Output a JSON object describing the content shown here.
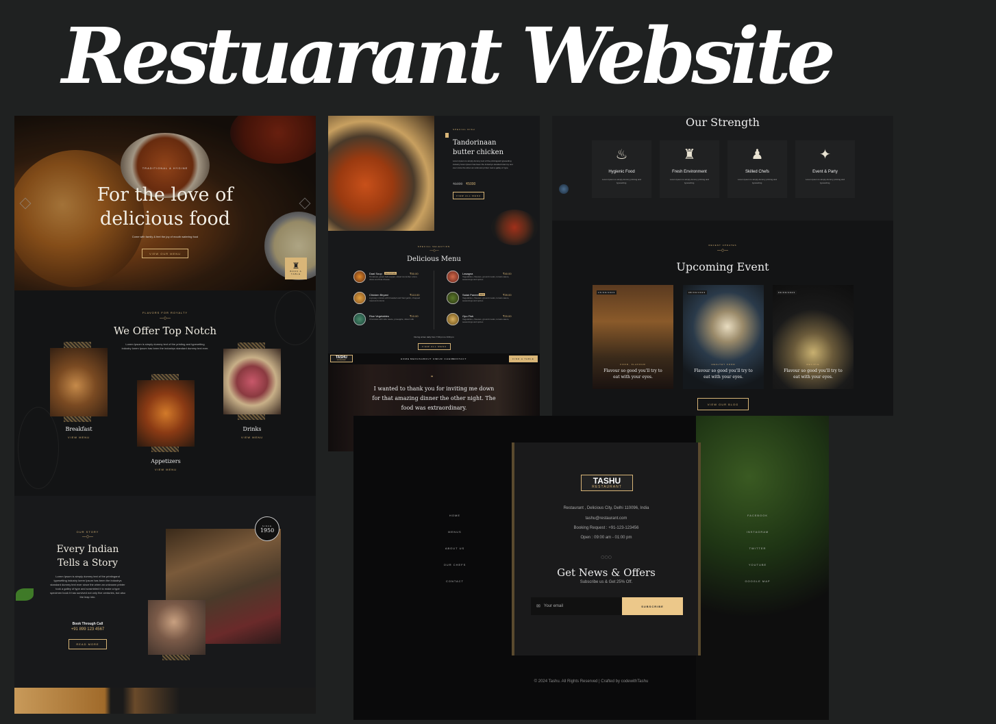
{
  "banner_title": "Restuarant Website",
  "hero": {
    "eyebrow": "TRADITIONAL & HYGINE",
    "title_line1": "For the love of",
    "title_line2": "delicious food",
    "subtitle": "Come with family & feel the joy of mouth watering food",
    "button": "VIEW OUR MENU",
    "book_label": "BOOK A TABLE"
  },
  "offer": {
    "eyebrow": "FLAVORS FOR ROYALTY",
    "title": "We Offer Top Notch",
    "desc": "Lorem Ipsum is simply dummy text of the printing and typesetting industry lorem Ipsum has been the industrys standard dummy text ever.",
    "items": [
      {
        "label": "Breakfast",
        "link": "VIEW MENU"
      },
      {
        "label": "Appetizers",
        "link": "VIEW MENU"
      },
      {
        "label": "Drinks",
        "link": "VIEW MENU"
      }
    ]
  },
  "story": {
    "eyebrow": "OUR STORY",
    "title_line1": "Every Indian",
    "title_line2": "Tells a Story",
    "desc": "Lorem Ipsum is simply dummy text of the printingand typesetting industry lorem Ipsum has been the industrys standard dummy text ever since the when an unknown printer took a galley of type and scrambled it to make a type specimen book It has survived not only five centuries, but also the leap into.",
    "book_label": "Book Through Call",
    "phone": "+91 899 123 4567",
    "button": "READ MORE",
    "badge_since": "SINCE",
    "badge_year": "1950"
  },
  "special": {
    "eyebrow": "SPECIAL DISH",
    "title_line1": "Tandorinaan",
    "title_line2": "butter chicken",
    "desc": "Lorem Ipsum is simply dummy text of the printingand typesetting industry lorem Ipsum has been the industrys standard dummy text ever since the when an unknown printer took a galley of type.",
    "old_price": "₹1000",
    "price": "₹5000",
    "button": "VIEW ALL MENU"
  },
  "menu": {
    "eyebrow": "SPECIAL SELECTION",
    "title": "Delicious Menu",
    "items": [
      {
        "name": "Daal Soup",
        "price": "₹50.00",
        "tag": "SEASONAL",
        "desc": "Tomatoes, green bell pepper, sliced cucumber onion, olives and feta cheese."
      },
      {
        "name": "Lasagna",
        "price": "₹40.00",
        "tag": "",
        "desc": "Vegetables, cheeses, ground meats, tomato sauce, seasonings and spices"
      },
      {
        "name": "Chicken Biryani",
        "price": "₹110.00",
        "tag": "",
        "desc": "A greasy mixture with breaded and fried garlic, chopped meat and onions"
      },
      {
        "name": "Salak Paneer",
        "price": "₹39.00",
        "tag": "NEW",
        "desc": "Vegetables, cheeses, ground meats, tomato sauce, seasonings and spices"
      },
      {
        "name": "Rice Vegetables",
        "price": "₹10.00",
        "tag": "",
        "desc": "Chocolate with side sauce, pineapple, sliced milk"
      },
      {
        "name": "Opo Fish",
        "price": "₹20.00",
        "tag": "",
        "desc": "Vegetables, cheeses, ground meats, tomato sauce, seasonings and spices"
      }
    ],
    "hours": "During winter daily from 7:00 pm to 9:00 pm",
    "button": "VIEW ALL MENU"
  },
  "navbar": {
    "logo_main": "TASHU",
    "logo_sub": "RESTAURANT",
    "links": [
      "HOME",
      "MENUS",
      "ABOUT US",
      "OUR CHEFS",
      "CONTACT"
    ],
    "button": "FIND A TABLE"
  },
  "testimonial": {
    "quote_line1": "I wanted to thank you for inviting me down",
    "quote_line2": "for that amazing dinner the other night. The",
    "quote_line3": "food was extraordinary."
  },
  "strength": {
    "title": "Our Strength",
    "items": [
      {
        "label": "Hygienic Food",
        "desc": "Lorem Ipsum is simply dummy printing and typesetting.",
        "icon": "hygienic-food-icon"
      },
      {
        "label": "Fresh Environment",
        "desc": "Lorem Ipsum is simply dummy printing and typesetting.",
        "icon": "fresh-environment-icon"
      },
      {
        "label": "Skilled Chefs",
        "desc": "Lorem Ipsum is simply dummy printing and typesetting.",
        "icon": "chef-icon"
      },
      {
        "label": "Event & Party",
        "desc": "Lorem Ipsum is simply dummy printing and typesetting.",
        "icon": "event-party-icon"
      }
    ]
  },
  "events": {
    "eyebrow": "RECENT UPDATES",
    "title": "Upcoming Event",
    "items": [
      {
        "date": "15/09/2023",
        "tag": "FOOD, FLAVOUR",
        "text_line1": "Flavour so good you'll try to",
        "text_line2": "eat with your eyes."
      },
      {
        "date": "08/09/2023",
        "tag": "HEALTHY FOOD",
        "text_line1": "Flavour so good you'll try to",
        "text_line2": "eat with your eyes."
      },
      {
        "date": "03/09/2023",
        "tag": "RECIPIE",
        "text_line1": "Flavour so good you'll try to",
        "text_line2": "eat with your eyes."
      }
    ],
    "button": "VIEW OUR BLOG"
  },
  "footer": {
    "logo_main": "TASHU",
    "logo_sub": "RESTAURANT",
    "address": "Restaurant , Delicious City, Delhi 110096, India",
    "email": "tashu@restaurant.com",
    "booking": "Booking Request : +91-123-123456",
    "hours": "Open : 09:00 am - 01:00 pm",
    "news_title": "Get News & Offers",
    "news_sub": "Subscribe us & Get 25% Off.",
    "email_placeholder": "Your email",
    "subscribe": "SUBSCRIBE",
    "left_links": [
      "HOME",
      "MENUS",
      "ABOUT US",
      "OUR CHEFS",
      "CONTACT"
    ],
    "right_links": [
      "FACEBOOK",
      "INSTAGRAM",
      "TWITTER",
      "YOUTUBE",
      "GOOGLE MAP"
    ],
    "copyright": "© 2024 Tashu. All Rights Reserved | Crafted by codewithTashu"
  },
  "colors": {
    "background": "#1f2121",
    "panel": "#111213",
    "gold": "#d9b678"
  }
}
